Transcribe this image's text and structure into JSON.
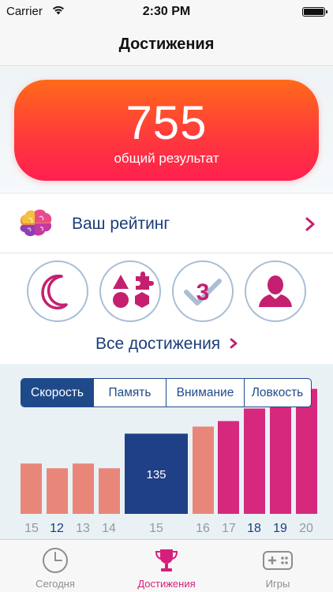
{
  "status_bar": {
    "carrier": "Carrier",
    "time": "2:30 PM"
  },
  "nav": {
    "title": "Достижения"
  },
  "score": {
    "value": "755",
    "caption": "общий результат"
  },
  "rating": {
    "label": "Ваш рейтинг"
  },
  "achievements": {
    "badges": [
      "moon-icon",
      "shapes-icon",
      "check-three-icon",
      "person-icon"
    ],
    "all_label": "Все достижения"
  },
  "tabs_segment": {
    "items": [
      "Скорость",
      "Память",
      "Внимание",
      "Ловкость"
    ],
    "selected": "Скорость"
  },
  "chart_data": {
    "type": "bar",
    "categories": [
      "15",
      "12",
      "13",
      "14",
      "15",
      "16",
      "17",
      "18",
      "19",
      "20"
    ],
    "values": [
      64,
      58,
      64,
      58,
      102,
      111,
      118,
      134,
      139,
      159
    ],
    "highlight_index": 4,
    "highlight_label": "135",
    "bold_categories": [
      "12",
      "18",
      "19"
    ],
    "colors": {
      "past": "#e8867a",
      "current": "#1f3f86",
      "recent": "#d6297e"
    },
    "xlabel": "",
    "ylabel": ""
  },
  "tab_bar": {
    "items": [
      {
        "label": "Сегодня",
        "icon": "clock-icon"
      },
      {
        "label": "Достижения",
        "icon": "trophy-icon"
      },
      {
        "label": "Игры",
        "icon": "gamepad-icon"
      }
    ],
    "active": "Достижения"
  },
  "colors": {
    "accent": "#d61f7a",
    "navy": "#1f4a8a",
    "score_top": "#ff6a1a",
    "score_bottom": "#ff1f4f"
  }
}
